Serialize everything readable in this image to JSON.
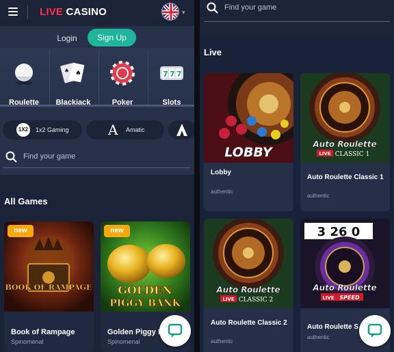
{
  "header": {
    "logo_live": "LIVE",
    "logo_casino": "CASINO",
    "menu_icon": "hamburger-icon",
    "flag": "uk-flag-icon"
  },
  "auth": {
    "login_label": "Login",
    "signup_label": "Sign Up"
  },
  "categories": [
    {
      "label": "Roulette",
      "icon": "roulette-ball-icon"
    },
    {
      "label": "Blackjack",
      "icon": "cards-icon"
    },
    {
      "label": "Poker",
      "icon": "poker-chip-icon"
    },
    {
      "label": "Slots",
      "icon": "slot-777-icon"
    }
  ],
  "providers": [
    {
      "label": "1x2 Gaming",
      "logo": "1X2"
    },
    {
      "label": "Amatic",
      "logo": "A"
    }
  ],
  "search": {
    "placeholder": "Find your game"
  },
  "all_games": {
    "title": "All Games",
    "games": [
      {
        "name": "Book of Rampage",
        "provider": "Spinomenal",
        "badge": "new",
        "art_text": "BOOK OF RAMPAGE"
      },
      {
        "name": "Golden Piggy B",
        "provider": "Spinomenal",
        "badge": "new",
        "art_text_1": "GOLDEN",
        "art_text_2": "PIGGY BANK"
      }
    ]
  },
  "live": {
    "title": "Live",
    "games": [
      {
        "name": "Lobby",
        "provider": "authentic",
        "art_text": "LOBBY"
      },
      {
        "name": "Auto Roulette Classic 1",
        "provider": "authentic",
        "art_title": "Auto Roulette",
        "art_tag": "LIVE",
        "art_sub": "CLASSIC 1"
      },
      {
        "name": "Auto Roulette Classic 2",
        "provider": "authentic",
        "art_title": "Auto Roulette",
        "art_tag": "LIVE",
        "art_sub": "CLASSIC 2"
      },
      {
        "name": "Auto Roulette S",
        "provider": "authentic",
        "art_title": "Auto Roulette",
        "art_tag": "LIVE",
        "art_sub": "SPEED",
        "art_numbers": "3 26 0"
      }
    ]
  },
  "colors": {
    "accent": "#1fb59b",
    "brand_red": "#ff2e4f",
    "badge": "#f5a90f",
    "panel": "#27324a"
  }
}
